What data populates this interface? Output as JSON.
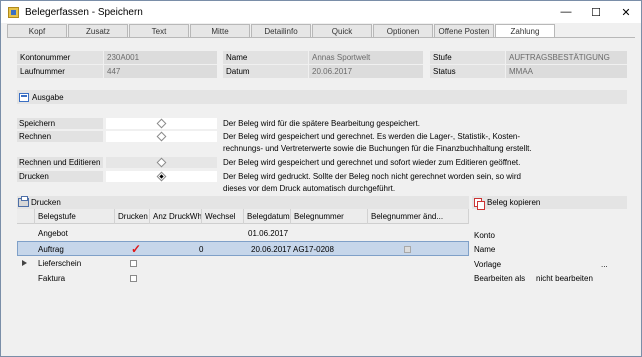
{
  "window": {
    "title": "Belegerfassen - Speichern",
    "min_glyph": "—",
    "max_glyph": "☐",
    "close_glyph": "✕"
  },
  "tabs": [
    "Kopf",
    "Zusatz",
    "Text",
    "Mitte",
    "Detailinfo",
    "Quick",
    "Optionen",
    "Offene Posten",
    "Zahlung"
  ],
  "info": {
    "kontonummer_label": "Kontonummer",
    "kontonummer_value": "230A001",
    "laufnummer_label": "Laufnummer",
    "laufnummer_value": "447",
    "name_label": "Name",
    "name_value": "Annas Sportwelt",
    "datum_label": "Datum",
    "datum_value": "20.06.2017",
    "stufe_label": "Stufe",
    "stufe_value": "AUFTRAGSBESTÄTIGUNG",
    "status_label": "Status",
    "status_value": "MMAA"
  },
  "ausgabe": {
    "header": "Ausgabe",
    "options": [
      {
        "label": "Speichern",
        "selected": false,
        "desc": "Der Beleg wird für die spätere Bearbeitung gespeichert."
      },
      {
        "label": "Rechnen",
        "selected": false,
        "desc": "Der Beleg wird gespeichert und gerechnet. Es werden die Lager-, Statistik-, Kosten-",
        "desc2": "rechnungs- und Vertreterwerte sowie die Buchungen für die Finanzbuchhaltung erstellt."
      },
      {
        "label": "Rechnen und Editieren",
        "selected": false,
        "desc": "Der Beleg wird gespeichert und gerechnet und sofort wieder zum Editieren geöffnet."
      },
      {
        "label": "Drucken",
        "selected": true,
        "desc": "Der Beleg wird gedruckt. Sollte der Beleg noch nicht gerechnet worden sein, so wird",
        "desc2": "dieses vor dem Druck automatisch durchgeführt."
      }
    ]
  },
  "drucken": {
    "header": "Drucken",
    "columns": [
      "Belegstufe",
      "Drucken",
      "Anz DruckWh.",
      "Wechsel",
      "Belegdatum",
      "Belegnummer",
      "Belegnummer änd..."
    ],
    "rows": [
      {
        "stufe": "Angebot",
        "drucken": "",
        "anz": "",
        "datum": "01.06.2017",
        "nummer": "",
        "has_check": false
      },
      {
        "stufe": "Auftrag",
        "drucken": "✓",
        "anz": "0",
        "datum": "20.06.2017",
        "nummer": "AG17-0208",
        "has_check": true
      },
      {
        "stufe": "Lieferschein",
        "drucken": "",
        "anz": "",
        "datum": "",
        "nummer": "",
        "has_check": false
      },
      {
        "stufe": "Faktura",
        "drucken": "",
        "anz": "",
        "datum": "",
        "nummer": "",
        "has_check": false
      }
    ]
  },
  "beleg_kopieren": {
    "header": "Beleg kopieren",
    "konto_label": "Konto",
    "name_label": "Name",
    "vorlage_label": "Vorlage",
    "vorlage_button": "...",
    "bearbeiten_label": "Bearbeiten als",
    "bearbeiten_value": "nicht bearbeiten"
  }
}
